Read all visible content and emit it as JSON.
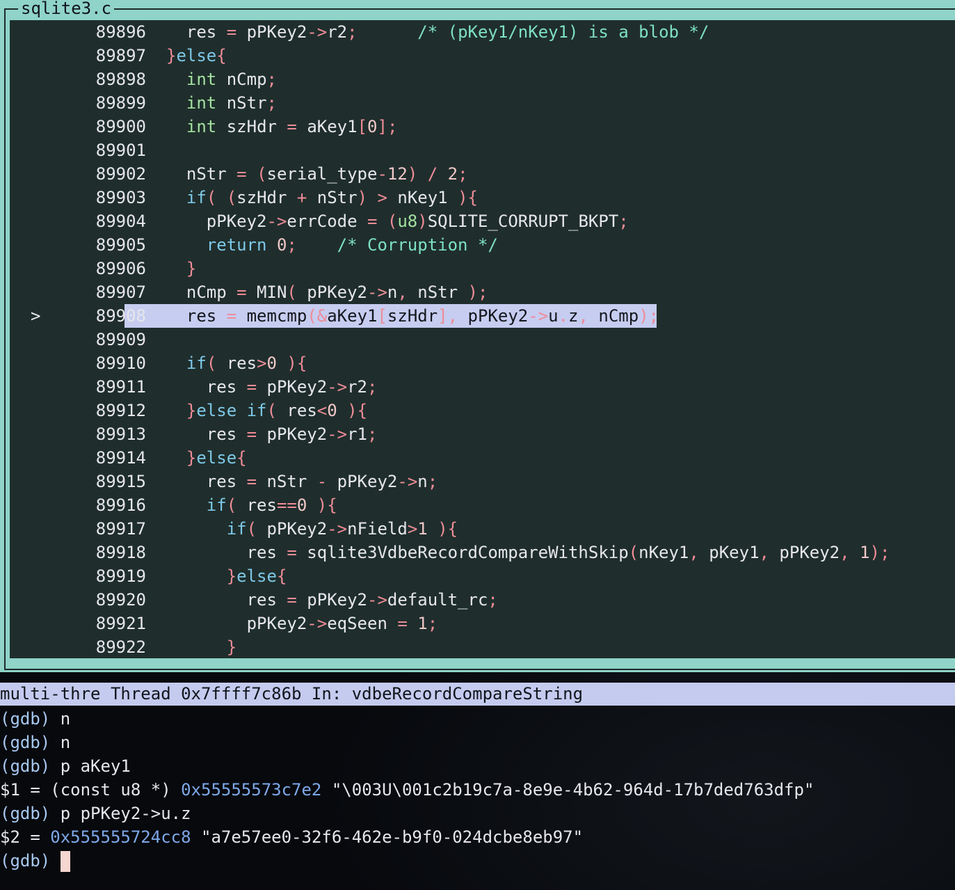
{
  "window": {
    "title": "sqlite3.c"
  },
  "source": {
    "lines": [
      {
        "no": "89896",
        "html": "  res = pPKey2->r2;      /* (pKey1/nKey1) is a blob */"
      },
      {
        "no": "89897",
        "html": "}else{"
      },
      {
        "no": "89898",
        "html": "  int nCmp;"
      },
      {
        "no": "89899",
        "html": "  int nStr;"
      },
      {
        "no": "89900",
        "html": "  int szHdr = aKey1[0];"
      },
      {
        "no": "89901",
        "html": ""
      },
      {
        "no": "89902",
        "html": "  nStr = (serial_type-12) / 2;"
      },
      {
        "no": "89903",
        "html": "  if( (szHdr + nStr) > nKey1 ){"
      },
      {
        "no": "89904",
        "html": "    pPKey2->errCode = (u8)SQLITE_CORRUPT_BKPT;"
      },
      {
        "no": "89905",
        "html": "    return 0;    /* Corruption */"
      },
      {
        "no": "89906",
        "html": "  }"
      },
      {
        "no": "89907",
        "html": "  nCmp = MIN( pPKey2->n, nStr );"
      },
      {
        "no": "89908",
        "html": "  res = memcmp(&aKey1[szHdr], pPKey2->u.z, nCmp);"
      },
      {
        "no": "89909",
        "html": ""
      },
      {
        "no": "89910",
        "html": "  if( res>0 ){"
      },
      {
        "no": "89911",
        "html": "    res = pPKey2->r2;"
      },
      {
        "no": "89912",
        "html": "  }else if( res<0 ){"
      },
      {
        "no": "89913",
        "html": "    res = pPKey2->r1;"
      },
      {
        "no": "89914",
        "html": "  }else{"
      },
      {
        "no": "89915",
        "html": "    res = nStr - pPKey2->n;"
      },
      {
        "no": "89916",
        "html": "    if( res==0 ){"
      },
      {
        "no": "89917",
        "html": "      if( pPKey2->nField>1 ){"
      },
      {
        "no": "89918",
        "html": "        res = sqlite3VdbeRecordCompareWithSkip(nKey1, pKey1, pPKey2, 1);"
      },
      {
        "no": "89919",
        "html": "      }else{"
      },
      {
        "no": "89920",
        "html": "        res = pPKey2->default_rc;"
      },
      {
        "no": "89921",
        "html": "        pPKey2->eqSeen = 1;"
      },
      {
        "no": "89922",
        "html": "      }"
      }
    ],
    "current_marker": ">",
    "current_line": "89908"
  },
  "status_bar": {
    "text": "multi-thre Thread 0x7ffff7c86b In: vdbeRecordCompareString"
  },
  "gdb": {
    "prompt": "(gdb)",
    "lines": [
      {
        "kind": "cmd",
        "text": " n"
      },
      {
        "kind": "cmd",
        "text": " n"
      },
      {
        "kind": "cmd",
        "text": " p aKey1"
      },
      {
        "kind": "out",
        "pre": "$1 = (const u8 *) ",
        "addr": "0x55555573c7e2",
        "post": " \"\\003U\\001c2b19c7a-8e9e-4b62-964d-17b7ded763dfp\""
      },
      {
        "kind": "cmd",
        "text": " p pPKey2->u.z"
      },
      {
        "kind": "out",
        "pre": "$2 = ",
        "addr": "0x555555724cc8",
        "post": " \"a7e57ee0-32f6-462e-b9f0-024dcbe8eb97\""
      },
      {
        "kind": "cmd",
        "text": " "
      }
    ]
  }
}
